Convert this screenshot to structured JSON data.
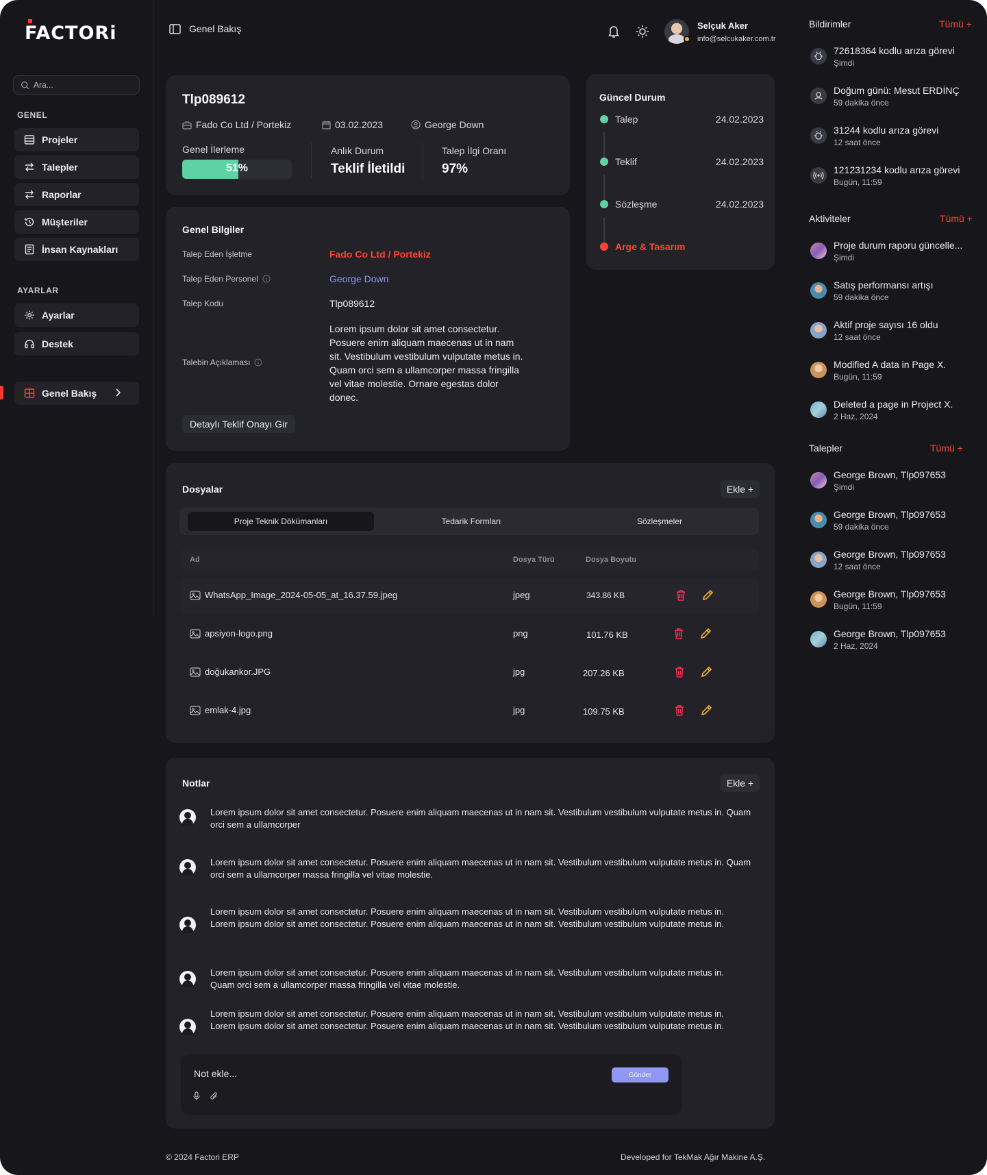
{
  "brand": {
    "logo_text": "FACTORi"
  },
  "search": {
    "placeholder": "Ara..."
  },
  "sidebar": {
    "section_general": "GENEL",
    "general_items": [
      {
        "label": "Projeler",
        "icon": "table-icon"
      },
      {
        "label": "Talepler",
        "icon": "arrows-swap-icon"
      },
      {
        "label": "Raporlar",
        "icon": "arrows-swap-icon"
      },
      {
        "label": "Müşteriler",
        "icon": "history-icon"
      },
      {
        "label": "İnsan Kaynakları",
        "icon": "document-icon"
      }
    ],
    "section_settings": "AYARLAR",
    "settings_items": [
      {
        "label": "Ayarlar",
        "icon": "gear-icon"
      },
      {
        "label": "Destek",
        "icon": "headset-icon"
      }
    ],
    "active_item": {
      "label": "Genel Bakış",
      "icon": "grid-icon"
    }
  },
  "header": {
    "title": "Genel Bakış",
    "user_name": "Selçuk Aker",
    "user_email": "info@selcukaker.com.tr"
  },
  "summary": {
    "code": "Tlp089612",
    "company": "Fado Co Ltd / Portekiz",
    "date": "03.02.2023",
    "person": "George Down",
    "progress_label": "Genel İlerleme",
    "progress_value": "51%",
    "progress_fraction": 0.51,
    "status_label": "Anlık Durum",
    "status_value": "Teklif İletildi",
    "interest_label": "Talep İlgi Oranı",
    "interest_value": "97%"
  },
  "current_status": {
    "title": "Güncel Durum",
    "steps": [
      {
        "label": "Talep",
        "date": "24.02.2023",
        "color": "#5fd2a5"
      },
      {
        "label": "Teklif",
        "date": "24.02.2023",
        "color": "#5fd2a5"
      },
      {
        "label": "Sözleşme",
        "date": "24.02.2023",
        "color": "#5fd2a5"
      },
      {
        "label": "Arge & Tasarım",
        "date": "",
        "color": "#ff4433"
      }
    ]
  },
  "general_info": {
    "title": "Genel Bilgiler",
    "rows": [
      {
        "label": "Talep Eden İşletme",
        "value": "Fado Co Ltd / Portekiz"
      },
      {
        "label": "Talep Eden Personel",
        "value": "George Down"
      },
      {
        "label": "Talep Kodu",
        "value": "Tlp089612"
      },
      {
        "label": "Talebin Açıklaması",
        "value": "Lorem ipsum dolor sit amet consectetur. Posuere enim aliquam maecenas ut in nam sit. Vestibulum vestibulum vulputate metus in. Quam orci sem a ullamcorper massa fringilla vel vitae molestie. Ornare egestas dolor donec."
      }
    ],
    "button": "Detaylı Teklif Onayı Gir"
  },
  "files": {
    "title": "Dosyalar",
    "add_button": "Ekle +",
    "tabs": [
      "Proje Teknik Dökümanları",
      "Tedarik Formları",
      "Sözleşmeler"
    ],
    "columns": [
      "Ad",
      "Dosya Türü",
      "Dosya Boyutu"
    ],
    "rows": [
      {
        "name": "WhatsApp_Image_2024-05-05_at_16.37.59.jpeg",
        "type": "jpeg",
        "size": "343.86 KB"
      },
      {
        "name": "apsiyon-logo.png",
        "type": "png",
        "size": "101.76 KB"
      },
      {
        "name": "doğukankor.JPG",
        "type": "jpg",
        "size": "207.26 KB"
      },
      {
        "name": "emlak-4.jpg",
        "type": "jpg",
        "size": "109.75 KB"
      }
    ]
  },
  "notes": {
    "title": "Notlar",
    "add_button": "Ekle +",
    "items": [
      "Lorem ipsum dolor sit amet consectetur. Posuere enim aliquam maecenas ut in nam sit. Vestibulum vestibulum vulputate metus in. Quam orci sem a ullamcorper",
      "Lorem ipsum dolor sit amet consectetur. Posuere enim aliquam maecenas ut in nam sit. Vestibulum vestibulum vulputate metus in. Quam orci sem a ullamcorper massa fringilla vel vitae molestie.",
      "Lorem ipsum dolor sit amet consectetur. Posuere enim aliquam maecenas ut in nam sit. Vestibulum vestibulum vulputate metus in. Lorem ipsum dolor sit amet consectetur. Posuere enim aliquam maecenas ut in nam sit. Vestibulum vestibulum vulputate metus in.",
      "Lorem ipsum dolor sit amet consectetur. Posuere enim aliquam maecenas ut in nam sit. Vestibulum vestibulum vulputate metus in. Quam orci sem a ullamcorper massa fringilla vel vitae molestie.",
      "Lorem ipsum dolor sit amet consectetur. Posuere enim aliquam maecenas ut in nam sit. Vestibulum vestibulum vulputate metus in. Lorem ipsum dolor sit amet consectetur. Posuere enim aliquam maecenas ut in nam sit. Vestibulum vestibulum vulputate metus in."
    ],
    "placeholder": "Not ekle...",
    "send": "Gönder"
  },
  "right_panel": {
    "notifications": {
      "title": "Bildirimler",
      "all": "Tümü +",
      "items": [
        {
          "text": "72618364 kodlu arıza görevi",
          "time": "Şimdi"
        },
        {
          "text": "Doğum günü: Mesut ERDİNÇ",
          "time": "59 dakika önce"
        },
        {
          "text": "31244 kodlu arıza görevi",
          "time": "12 saat önce"
        },
        {
          "text": "121231234 kodlu arıza görevi",
          "time": "Bugün, 11:59"
        }
      ]
    },
    "activities": {
      "title": "Aktiviteler",
      "all": "Tümü +",
      "items": [
        {
          "text": "Proje durum raporu güncelle...",
          "time": "Şimdi"
        },
        {
          "text": "Satış performansı artışı",
          "time": "59 dakika önce"
        },
        {
          "text": "Aktif proje sayısı 16 oldu",
          "time": "12 saat önce"
        },
        {
          "text": "Modified A data in Page X.",
          "time": "Bugün, 11:59"
        },
        {
          "text": "Deleted a page in Project X.",
          "time": "2 Haz, 2024"
        }
      ]
    },
    "requests": {
      "title": "Talepler",
      "all": "Tümü +",
      "items": [
        {
          "text": "George Brown, Tlp097653",
          "time": "Şimdi"
        },
        {
          "text": "George Brown, Tlp097653",
          "time": "59 dakika önce"
        },
        {
          "text": "George Brown, Tlp097653",
          "time": "12 saat önce"
        },
        {
          "text": "George Brown, Tlp097653",
          "time": "Bugün, 11:59"
        },
        {
          "text": "George Brown, Tlp097653",
          "time": "2 Haz, 2024"
        }
      ]
    }
  },
  "footer": {
    "left": "© 2024 Factori ERP",
    "right": "Developed for TekMak Ağır Makine A.Ş."
  },
  "colors": {
    "accent": "#ff4433",
    "success": "#5fd2a5",
    "link": "#8f97f0",
    "warning": "#f2b134",
    "danger": "#ff2d55"
  }
}
